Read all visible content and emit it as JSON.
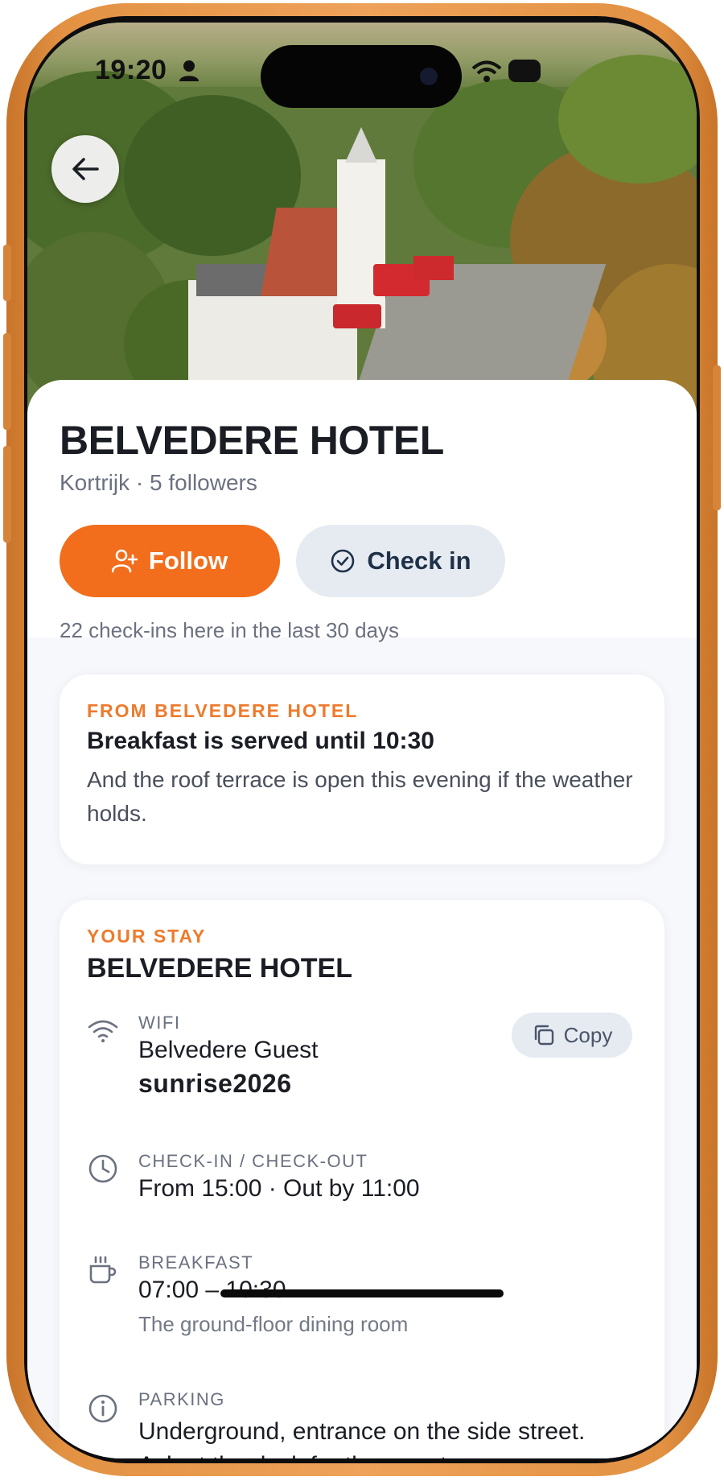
{
  "status_bar": {
    "time": "19:20"
  },
  "hotel": {
    "name": "BELVEDERE HOTEL",
    "location": "Kortrijk",
    "separator": "·",
    "followers": "5 followers",
    "checkins_note": "22 check-ins here in the last 30 days"
  },
  "actions": {
    "follow_label": "Follow",
    "checkin_label": "Check in"
  },
  "message": {
    "eyebrow": "FROM BELVEDERE HOTEL",
    "title": "Breakfast is served until 10:30",
    "body": "And the roof terrace is open this evening if the weather holds."
  },
  "stay": {
    "eyebrow": "YOUR STAY",
    "title": "BELVEDERE HOTEL",
    "wifi": {
      "label": "WIFI",
      "network": "Belvedere Guest",
      "password": "sunrise2026",
      "copy_label": "Copy"
    },
    "checkin_checkout": {
      "label": "CHECK-IN / CHECK-OUT",
      "value": "From 15:00 · Out by 11:00"
    },
    "breakfast": {
      "label": "BREAKFAST",
      "value": "07:00 – 10:30",
      "sub": "The ground-floor dining room"
    },
    "parking": {
      "label": "PARKING",
      "value": "Underground, entrance on the side street. Ask at the desk for the remote."
    }
  },
  "colors": {
    "accent": "#f26e1c",
    "eyebrow": "#ee7a2c",
    "frame": "#e39243",
    "secondary_button": "#e6ebf2"
  }
}
